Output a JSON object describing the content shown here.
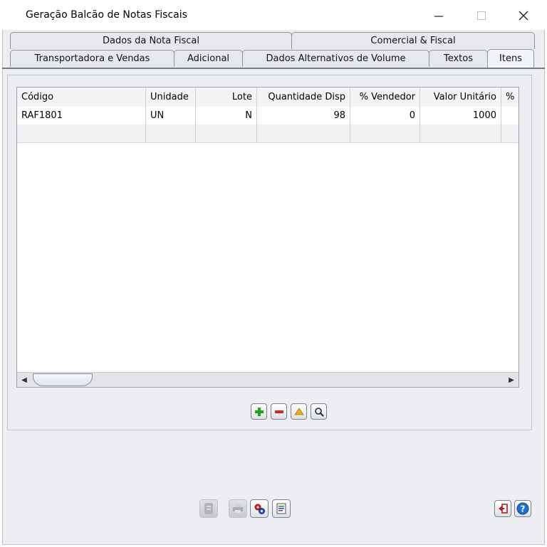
{
  "window": {
    "title": "Geração Balcão de Notas Fiscais"
  },
  "tabs_row1": [
    "Dados da Nota Fiscal",
    "Comercial & Fiscal"
  ],
  "tabs_row2": [
    "Transportadora e Vendas",
    "Adicional",
    "Dados Alternativos de Volume",
    "Textos",
    "Itens"
  ],
  "active_tab": "Itens",
  "grid": {
    "columns": [
      "Código",
      "Unidade",
      "Lote",
      "Quantidade Disp",
      "% Vendedor",
      "Valor Unitário",
      "%"
    ],
    "rows": [
      [
        "RAF1801",
        "UN",
        "N",
        "98",
        "0",
        "1000",
        ""
      ]
    ]
  },
  "icons": {
    "add": "plus-icon",
    "remove": "minus-icon",
    "up": "arrow-up-icon",
    "search": "magnifier-icon",
    "doc": "document-icon",
    "print": "printer-icon",
    "process": "gears-icon",
    "report": "report-icon",
    "exit": "exit-icon",
    "help": "help-icon"
  },
  "colors": {
    "add": "#22a022",
    "remove": "#d32626",
    "up": "#f0a818",
    "exit": "#b11e1e",
    "help": "#1f6fd0"
  }
}
